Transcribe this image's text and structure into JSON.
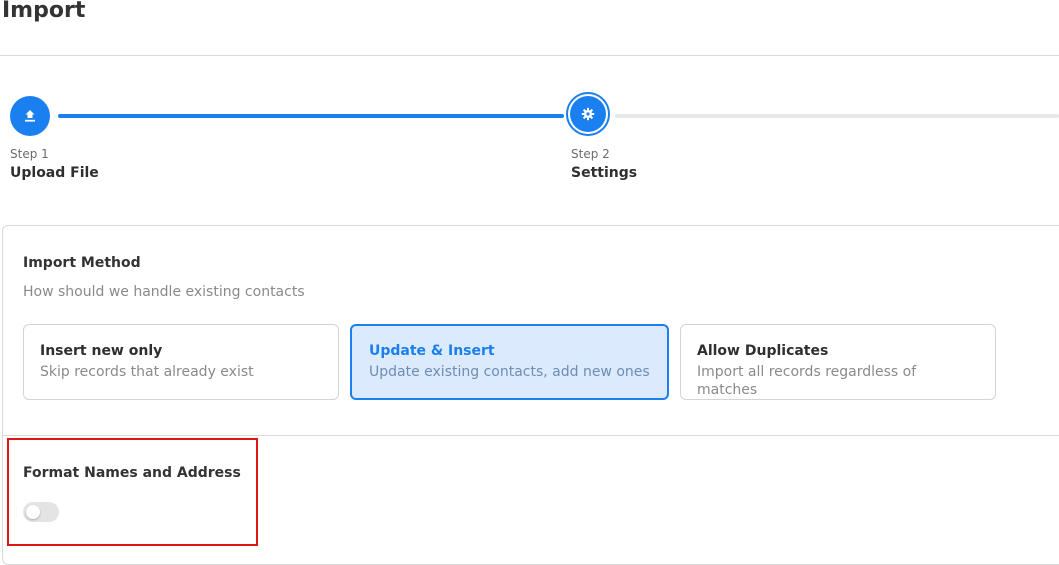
{
  "page": {
    "title": "Import"
  },
  "stepper": {
    "steps": [
      {
        "caption": "Step 1",
        "name": "Upload File",
        "icon": "upload-icon",
        "state": "completed"
      },
      {
        "caption": "Step 2",
        "name": "Settings",
        "icon": "gear-icon",
        "state": "active"
      }
    ]
  },
  "import_method": {
    "title": "Import Method",
    "subtitle": "How should we handle existing contacts",
    "options": [
      {
        "title": "Insert new only",
        "description": "Skip records that already exist",
        "selected": false
      },
      {
        "title": "Update & Insert",
        "description": "Update existing contacts, add new ones",
        "selected": true
      },
      {
        "title": "Allow Duplicates",
        "description": "Import all records regardless of matches",
        "selected": false
      }
    ]
  },
  "format": {
    "title": "Format Names and Address",
    "enabled": false
  },
  "colors": {
    "accent": "#1a7fef",
    "selected_bg": "#dbeafc",
    "highlight": "#e01515"
  }
}
